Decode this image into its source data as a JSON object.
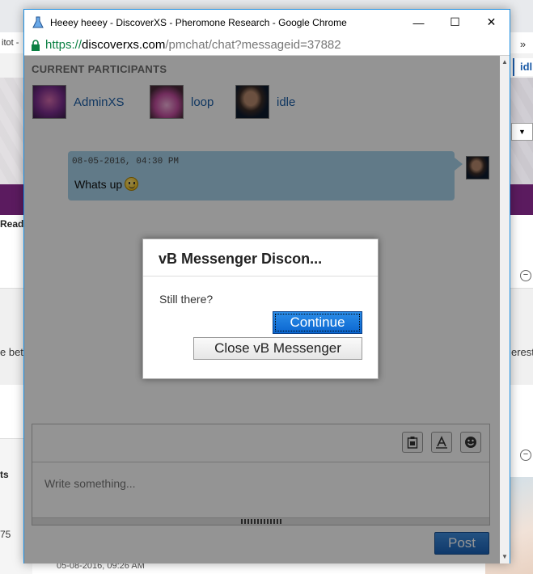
{
  "background": {
    "tab_fragment": "itot -",
    "tab_arrows": "»",
    "user_fragment": "idl",
    "read_label": "Read",
    "left_text": "e bet",
    "right_text": "erest",
    "column_label": "ts",
    "count": "75",
    "date_fragment": "05-08-2016, 09:26 AM"
  },
  "window": {
    "title": "Heeey heeey - DiscoverXS - Pheromone Research - Google Chrome",
    "minimize": "—",
    "maximize": "☐",
    "close": "✕"
  },
  "address": {
    "scheme": "https://",
    "host": "discoverxs.com",
    "path": "/pmchat/chat?messageid=37882"
  },
  "chat": {
    "participants_title": "CURRENT PARTICIPANTS",
    "participants": [
      {
        "name": "AdminXS"
      },
      {
        "name": "loop"
      },
      {
        "name": "idle"
      }
    ],
    "message": {
      "time": "08-05-2016, 04:30 PM",
      "text": "Whats up"
    },
    "composer_placeholder": "Write something...",
    "post_label": "Post"
  },
  "dialog": {
    "title": "vB Messenger Discon...",
    "body": "Still there?",
    "continue_label": "Continue",
    "close_label": "Close vB Messenger"
  },
  "colors": {
    "accent": "#1b63b8",
    "link": "#1d5fa8",
    "bubble": "#a7d3eb"
  }
}
